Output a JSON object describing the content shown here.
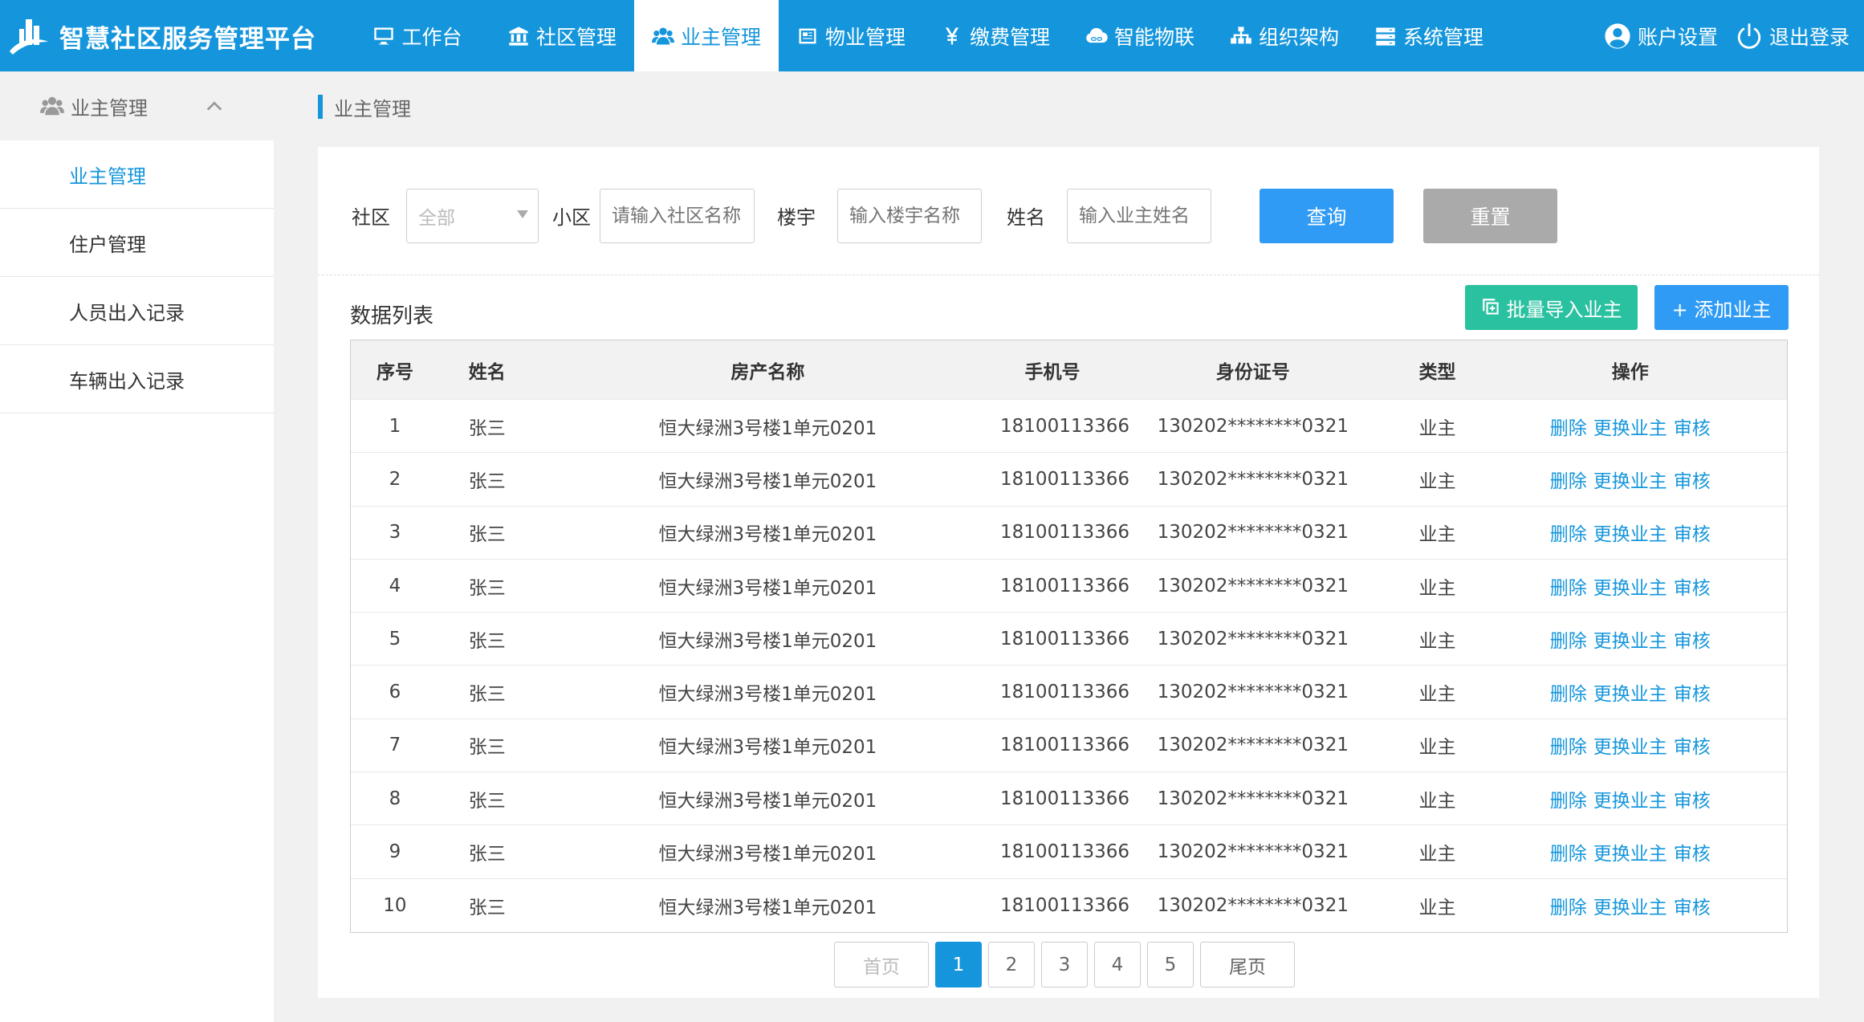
{
  "app": {
    "title": "智慧社区服务管理平台"
  },
  "nav": {
    "items": [
      {
        "label": "工作台",
        "icon": "monitor-icon"
      },
      {
        "label": "社区管理",
        "icon": "bank-icon"
      },
      {
        "label": "业主管理",
        "icon": "users-icon",
        "active": true
      },
      {
        "label": "物业管理",
        "icon": "newspaper-icon"
      },
      {
        "label": "缴费管理",
        "icon": "yen-icon"
      },
      {
        "label": "智能物联",
        "icon": "cloud-link-icon"
      },
      {
        "label": "组织架构",
        "icon": "sitemap-icon"
      },
      {
        "label": "系统管理",
        "icon": "server-icon"
      }
    ],
    "account": "账户设置",
    "logout": "退出登录"
  },
  "sidebar": {
    "header": "业主管理",
    "items": [
      {
        "label": "业主管理",
        "active": true
      },
      {
        "label": "住户管理"
      },
      {
        "label": "人员出入记录"
      },
      {
        "label": "车辆出入记录"
      }
    ]
  },
  "breadcrumb": "业主管理",
  "filters": {
    "community_label": "社区",
    "community_value": "全部",
    "district_label": "小区",
    "district_placeholder": "请输入社区名称",
    "building_label": "楼宇",
    "building_placeholder": "输入楼宇名称",
    "name_label": "姓名",
    "name_placeholder": "输入业主姓名",
    "search": "查询",
    "reset": "重置"
  },
  "list": {
    "title": "数据列表",
    "import": "批量导入业主",
    "add": "+ 添加业主",
    "columns": [
      "序号",
      "姓名",
      "房产名称",
      "手机号",
      "身份证号",
      "类型",
      "操作"
    ],
    "rows": [
      {
        "no": "1",
        "name": "张三",
        "property": "恒大绿洲3号楼1单元0201",
        "phone": "18100113366",
        "id": "130202********0321",
        "type": "业主"
      },
      {
        "no": "2",
        "name": "张三",
        "property": "恒大绿洲3号楼1单元0201",
        "phone": "18100113366",
        "id": "130202********0321",
        "type": "业主"
      },
      {
        "no": "3",
        "name": "张三",
        "property": "恒大绿洲3号楼1单元0201",
        "phone": "18100113366",
        "id": "130202********0321",
        "type": "业主"
      },
      {
        "no": "4",
        "name": "张三",
        "property": "恒大绿洲3号楼1单元0201",
        "phone": "18100113366",
        "id": "130202********0321",
        "type": "业主"
      },
      {
        "no": "5",
        "name": "张三",
        "property": "恒大绿洲3号楼1单元0201",
        "phone": "18100113366",
        "id": "130202********0321",
        "type": "业主"
      },
      {
        "no": "6",
        "name": "张三",
        "property": "恒大绿洲3号楼1单元0201",
        "phone": "18100113366",
        "id": "130202********0321",
        "type": "业主"
      },
      {
        "no": "7",
        "name": "张三",
        "property": "恒大绿洲3号楼1单元0201",
        "phone": "18100113366",
        "id": "130202********0321",
        "type": "业主"
      },
      {
        "no": "8",
        "name": "张三",
        "property": "恒大绿洲3号楼1单元0201",
        "phone": "18100113366",
        "id": "130202********0321",
        "type": "业主"
      },
      {
        "no": "9",
        "name": "张三",
        "property": "恒大绿洲3号楼1单元0201",
        "phone": "18100113366",
        "id": "130202********0321",
        "type": "业主"
      },
      {
        "no": "10",
        "name": "张三",
        "property": "恒大绿洲3号楼1单元0201",
        "phone": "18100113366",
        "id": "130202********0321",
        "type": "业主"
      }
    ],
    "actions": [
      "删除",
      "更换业主",
      "审核"
    ]
  },
  "pager": {
    "first": "首页",
    "last": "尾页",
    "pages": [
      "1",
      "2",
      "3",
      "4",
      "5"
    ],
    "current": "1"
  },
  "colors": {
    "primary": "#1596dc",
    "search": "#2f9bf5",
    "reset": "#aaaaaa",
    "import": "#2ac1a0",
    "add": "#2f9bf5"
  }
}
